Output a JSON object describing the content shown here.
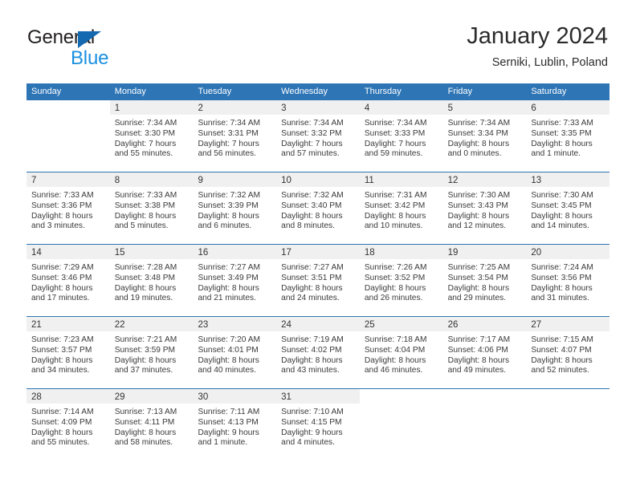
{
  "brand": {
    "name_part1": "General",
    "name_part2": "Blue",
    "logo_icon": "triangle-icon"
  },
  "header": {
    "title": "January 2024",
    "subtitle": "Serniki, Lublin, Poland"
  },
  "colors": {
    "header_blue": "#2E75B6",
    "brand_dark_blue": "#1569B0",
    "brand_light_blue": "#1A8FE0",
    "date_band_gray": "#F0F0F0",
    "text": "#262626"
  },
  "calendar": {
    "weekdays": [
      "Sunday",
      "Monday",
      "Tuesday",
      "Wednesday",
      "Thursday",
      "Friday",
      "Saturday"
    ],
    "weeks": [
      [
        {
          "day": "",
          "lines": []
        },
        {
          "day": "1",
          "lines": [
            "Sunrise: 7:34 AM",
            "Sunset: 3:30 PM",
            "Daylight: 7 hours",
            "and 55 minutes."
          ]
        },
        {
          "day": "2",
          "lines": [
            "Sunrise: 7:34 AM",
            "Sunset: 3:31 PM",
            "Daylight: 7 hours",
            "and 56 minutes."
          ]
        },
        {
          "day": "3",
          "lines": [
            "Sunrise: 7:34 AM",
            "Sunset: 3:32 PM",
            "Daylight: 7 hours",
            "and 57 minutes."
          ]
        },
        {
          "day": "4",
          "lines": [
            "Sunrise: 7:34 AM",
            "Sunset: 3:33 PM",
            "Daylight: 7 hours",
            "and 59 minutes."
          ]
        },
        {
          "day": "5",
          "lines": [
            "Sunrise: 7:34 AM",
            "Sunset: 3:34 PM",
            "Daylight: 8 hours",
            "and 0 minutes."
          ]
        },
        {
          "day": "6",
          "lines": [
            "Sunrise: 7:33 AM",
            "Sunset: 3:35 PM",
            "Daylight: 8 hours",
            "and 1 minute."
          ]
        }
      ],
      [
        {
          "day": "7",
          "lines": [
            "Sunrise: 7:33 AM",
            "Sunset: 3:36 PM",
            "Daylight: 8 hours",
            "and 3 minutes."
          ]
        },
        {
          "day": "8",
          "lines": [
            "Sunrise: 7:33 AM",
            "Sunset: 3:38 PM",
            "Daylight: 8 hours",
            "and 5 minutes."
          ]
        },
        {
          "day": "9",
          "lines": [
            "Sunrise: 7:32 AM",
            "Sunset: 3:39 PM",
            "Daylight: 8 hours",
            "and 6 minutes."
          ]
        },
        {
          "day": "10",
          "lines": [
            "Sunrise: 7:32 AM",
            "Sunset: 3:40 PM",
            "Daylight: 8 hours",
            "and 8 minutes."
          ]
        },
        {
          "day": "11",
          "lines": [
            "Sunrise: 7:31 AM",
            "Sunset: 3:42 PM",
            "Daylight: 8 hours",
            "and 10 minutes."
          ]
        },
        {
          "day": "12",
          "lines": [
            "Sunrise: 7:30 AM",
            "Sunset: 3:43 PM",
            "Daylight: 8 hours",
            "and 12 minutes."
          ]
        },
        {
          "day": "13",
          "lines": [
            "Sunrise: 7:30 AM",
            "Sunset: 3:45 PM",
            "Daylight: 8 hours",
            "and 14 minutes."
          ]
        }
      ],
      [
        {
          "day": "14",
          "lines": [
            "Sunrise: 7:29 AM",
            "Sunset: 3:46 PM",
            "Daylight: 8 hours",
            "and 17 minutes."
          ]
        },
        {
          "day": "15",
          "lines": [
            "Sunrise: 7:28 AM",
            "Sunset: 3:48 PM",
            "Daylight: 8 hours",
            "and 19 minutes."
          ]
        },
        {
          "day": "16",
          "lines": [
            "Sunrise: 7:27 AM",
            "Sunset: 3:49 PM",
            "Daylight: 8 hours",
            "and 21 minutes."
          ]
        },
        {
          "day": "17",
          "lines": [
            "Sunrise: 7:27 AM",
            "Sunset: 3:51 PM",
            "Daylight: 8 hours",
            "and 24 minutes."
          ]
        },
        {
          "day": "18",
          "lines": [
            "Sunrise: 7:26 AM",
            "Sunset: 3:52 PM",
            "Daylight: 8 hours",
            "and 26 minutes."
          ]
        },
        {
          "day": "19",
          "lines": [
            "Sunrise: 7:25 AM",
            "Sunset: 3:54 PM",
            "Daylight: 8 hours",
            "and 29 minutes."
          ]
        },
        {
          "day": "20",
          "lines": [
            "Sunrise: 7:24 AM",
            "Sunset: 3:56 PM",
            "Daylight: 8 hours",
            "and 31 minutes."
          ]
        }
      ],
      [
        {
          "day": "21",
          "lines": [
            "Sunrise: 7:23 AM",
            "Sunset: 3:57 PM",
            "Daylight: 8 hours",
            "and 34 minutes."
          ]
        },
        {
          "day": "22",
          "lines": [
            "Sunrise: 7:21 AM",
            "Sunset: 3:59 PM",
            "Daylight: 8 hours",
            "and 37 minutes."
          ]
        },
        {
          "day": "23",
          "lines": [
            "Sunrise: 7:20 AM",
            "Sunset: 4:01 PM",
            "Daylight: 8 hours",
            "and 40 minutes."
          ]
        },
        {
          "day": "24",
          "lines": [
            "Sunrise: 7:19 AM",
            "Sunset: 4:02 PM",
            "Daylight: 8 hours",
            "and 43 minutes."
          ]
        },
        {
          "day": "25",
          "lines": [
            "Sunrise: 7:18 AM",
            "Sunset: 4:04 PM",
            "Daylight: 8 hours",
            "and 46 minutes."
          ]
        },
        {
          "day": "26",
          "lines": [
            "Sunrise: 7:17 AM",
            "Sunset: 4:06 PM",
            "Daylight: 8 hours",
            "and 49 minutes."
          ]
        },
        {
          "day": "27",
          "lines": [
            "Sunrise: 7:15 AM",
            "Sunset: 4:07 PM",
            "Daylight: 8 hours",
            "and 52 minutes."
          ]
        }
      ],
      [
        {
          "day": "28",
          "lines": [
            "Sunrise: 7:14 AM",
            "Sunset: 4:09 PM",
            "Daylight: 8 hours",
            "and 55 minutes."
          ]
        },
        {
          "day": "29",
          "lines": [
            "Sunrise: 7:13 AM",
            "Sunset: 4:11 PM",
            "Daylight: 8 hours",
            "and 58 minutes."
          ]
        },
        {
          "day": "30",
          "lines": [
            "Sunrise: 7:11 AM",
            "Sunset: 4:13 PM",
            "Daylight: 9 hours",
            "and 1 minute."
          ]
        },
        {
          "day": "31",
          "lines": [
            "Sunrise: 7:10 AM",
            "Sunset: 4:15 PM",
            "Daylight: 9 hours",
            "and 4 minutes."
          ]
        },
        {
          "day": "",
          "lines": []
        },
        {
          "day": "",
          "lines": []
        },
        {
          "day": "",
          "lines": []
        }
      ]
    ]
  }
}
